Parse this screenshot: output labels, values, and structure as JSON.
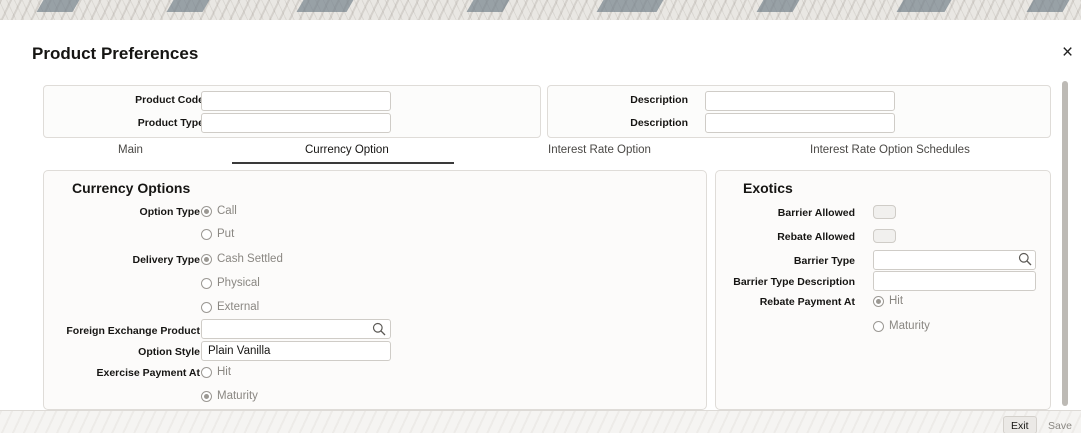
{
  "window": {
    "title": "Product Preferences",
    "close_glyph": "×"
  },
  "header": {
    "product_code_label": "Product Code",
    "product_code_value": "",
    "product_type_label": "Product Type",
    "product_type_value": "",
    "description_label_1": "Description",
    "description_value_1": "",
    "description_label_2": "Description",
    "description_value_2": ""
  },
  "tabs": [
    {
      "label": "Main",
      "active": false
    },
    {
      "label": "Currency Option",
      "active": true
    },
    {
      "label": "Interest Rate Option",
      "active": false
    },
    {
      "label": "Interest Rate Option Schedules",
      "active": false
    }
  ],
  "currency_options": {
    "title": "Currency Options",
    "option_type_label": "Option Type",
    "option_type_choices": [
      "Call",
      "Put"
    ],
    "option_type_selected": "Call",
    "delivery_type_label": "Delivery Type",
    "delivery_type_choices": [
      "Cash Settled",
      "Physical",
      "External"
    ],
    "delivery_type_selected": "Cash Settled",
    "fx_product_label": "Foreign Exchange Product",
    "fx_product_value": "",
    "option_style_label": "Option Style",
    "option_style_value": "Plain Vanilla",
    "exercise_payment_label": "Exercise Payment At",
    "exercise_payment_choices": [
      "Hit",
      "Maturity"
    ],
    "exercise_payment_selected": "Maturity"
  },
  "exotics": {
    "title": "Exotics",
    "barrier_allowed_label": "Barrier Allowed",
    "barrier_allowed": false,
    "rebate_allowed_label": "Rebate Allowed",
    "rebate_allowed": false,
    "barrier_type_label": "Barrier Type",
    "barrier_type_value": "",
    "barrier_type_desc_label": "Barrier Type Description",
    "barrier_type_desc_value": "",
    "rebate_payment_label": "Rebate Payment At",
    "rebate_payment_choices": [
      "Hit",
      "Maturity"
    ],
    "rebate_payment_selected": "Hit"
  },
  "footer": {
    "exit_label": "Exit",
    "save_label": "Save"
  },
  "icons": {
    "search": "search-icon",
    "close": "close-icon"
  }
}
